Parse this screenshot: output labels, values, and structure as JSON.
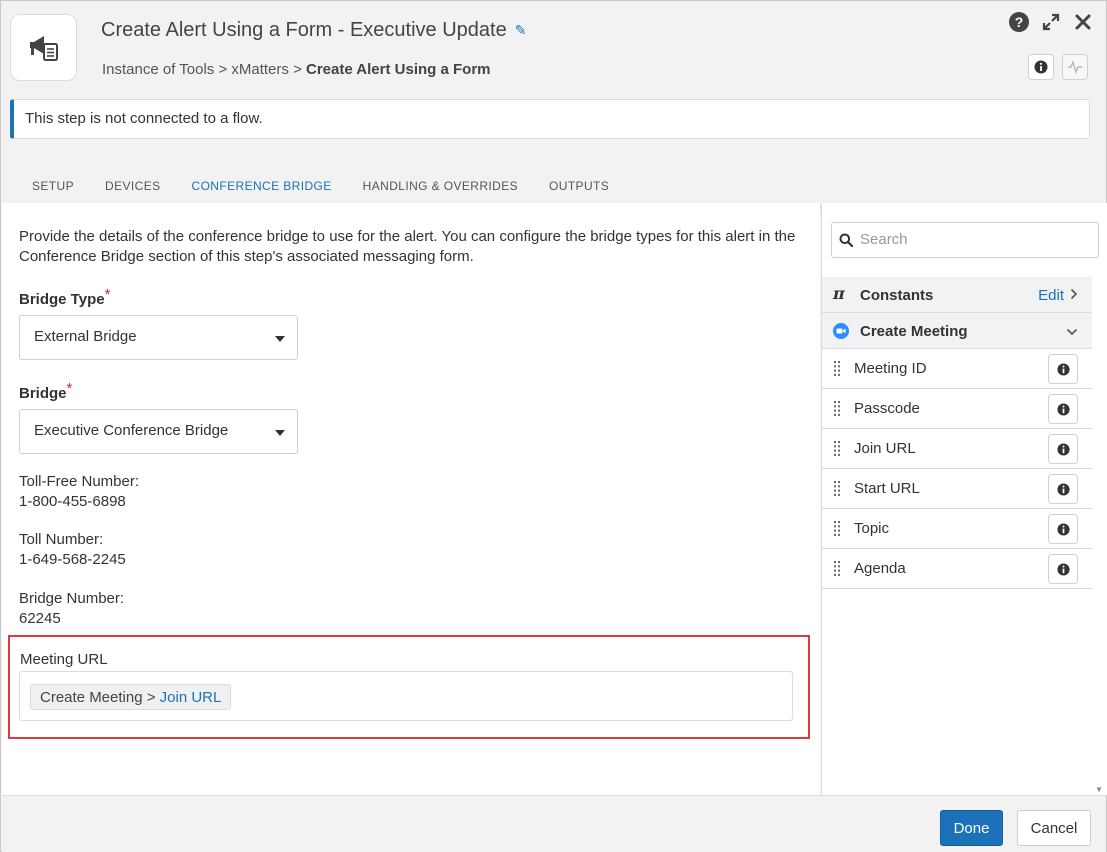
{
  "header": {
    "title": "Create Alert Using a Form - Executive Update",
    "breadcrumb_prefix": "Instance of Tools > xMatters > ",
    "breadcrumb_current": "Create Alert Using a Form"
  },
  "notice": "This step is not connected to a flow.",
  "tabs": [
    "SETUP",
    "DEVICES",
    "CONFERENCE BRIDGE",
    "HANDLING & OVERRIDES",
    "OUTPUTS"
  ],
  "active_tab": "CONFERENCE BRIDGE",
  "form": {
    "description": "Provide the details of the conference bridge to use for the alert. You can configure the bridge types for this alert in the Conference Bridge section of this step's associated messaging form.",
    "bridge_type_label": "Bridge Type",
    "bridge_type_value": "External Bridge",
    "bridge_label": "Bridge",
    "bridge_value": "Executive Conference Bridge",
    "required_mark": "*",
    "toll_free_label": "Toll-Free Number:",
    "toll_free_value": "1-800-455-6898",
    "toll_label": "Toll Number:",
    "toll_value": "1-649-568-2245",
    "bridge_number_label": "Bridge Number:",
    "bridge_number_value": "62245",
    "meeting_url_label": "Meeting URL",
    "meeting_url_chip_prefix": "Create Meeting > ",
    "meeting_url_chip_link": "Join URL"
  },
  "panel": {
    "search_placeholder": "Search",
    "constants_label": "Constants",
    "constants_edit": "Edit",
    "create_meeting_label": "Create Meeting",
    "items": [
      "Meeting ID",
      "Passcode",
      "Join URL",
      "Start URL",
      "Topic",
      "Agenda"
    ]
  },
  "footer": {
    "done": "Done",
    "cancel": "Cancel"
  },
  "colors": {
    "accent": "#1c72b8",
    "highlight": "#e0383e",
    "required": "#d6262f"
  }
}
